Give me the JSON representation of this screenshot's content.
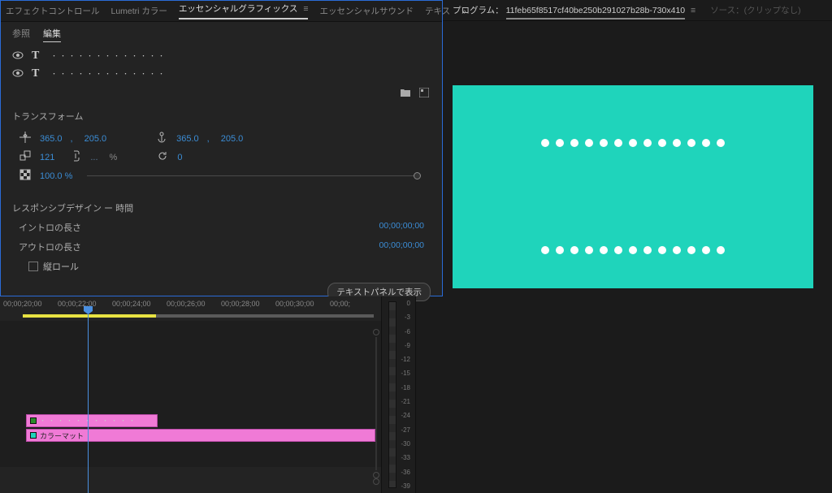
{
  "tabs": {
    "effect": "エフェクトコントロール",
    "lumetri": "Lumetri カラー",
    "ess_gfx": "エッセンシャルグラフィックス",
    "ess_snd": "エッセンシャルサウンド",
    "text": "テキス"
  },
  "sub_tabs": {
    "browse": "参照",
    "edit": "編集"
  },
  "layers": {
    "layer1": "・・・・・・・・・・・・・",
    "layer2": "・・・・・・・・・・・・・"
  },
  "transform": {
    "title": "トランスフォーム",
    "pos_x": "365.0",
    "pos_y": "205.0",
    "anchor_x": "365.0",
    "anchor_y": "205.0",
    "scale": "121",
    "scale_link": "...",
    "pct_sym": "%",
    "rotation": "0",
    "opacity": "100.0 %"
  },
  "responsive": {
    "title": "レスポンシブデザイン ー 時間",
    "intro_label": "イントロの長さ",
    "intro_tc": "00;00;00;00",
    "outro_label": "アウトロの長さ",
    "outro_tc": "00;00;00;00",
    "roll": "縦ロール"
  },
  "footer_btn": "テキストパネルで表示",
  "program": {
    "label": "プログラム：",
    "name": "11feb65f8517cf40be250b291027b28b-730x410",
    "source": "ソース：(クリップなし)"
  },
  "timeline": {
    "tcs": [
      "00;00;20;00",
      "00;00;22;00",
      "00;00;24;00",
      "00;00;26;00",
      "00;00;28;00",
      "00;00;30;00",
      "00;00;"
    ],
    "gfx_clip": "・・・・・・・・・・・",
    "mat_clip": "カラーマット"
  },
  "meters": [
    "0",
    "-3",
    "-6",
    "-9",
    "-12",
    "-15",
    "-18",
    "-21",
    "-24",
    "-27",
    "-30",
    "-33",
    "-36",
    "-39"
  ]
}
